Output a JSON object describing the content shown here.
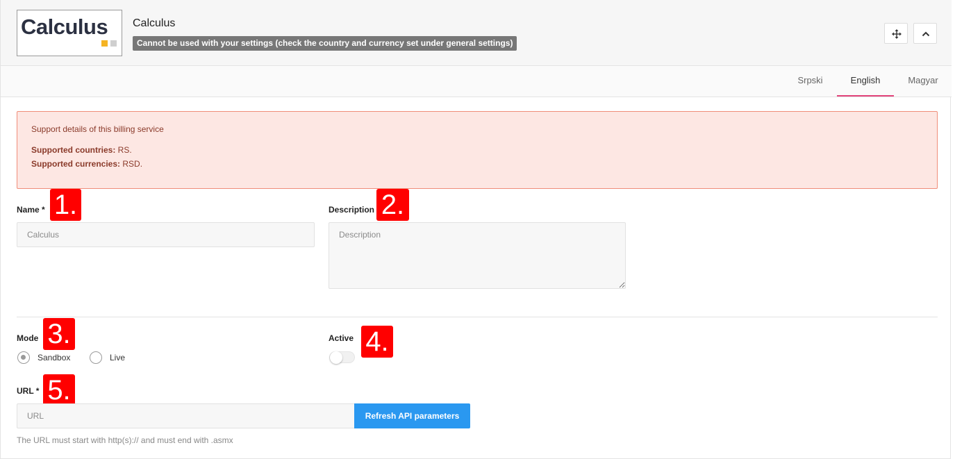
{
  "header": {
    "logo_text": "Calculus",
    "title": "Calculus",
    "badge": "Cannot be used with your settings (check the country and currency set under general settings)",
    "move_icon": "move-icon",
    "collapse_icon": "chevron-up-icon"
  },
  "tabs": [
    {
      "label": "Srpski",
      "active": false
    },
    {
      "label": "English",
      "active": true
    },
    {
      "label": "Magyar",
      "active": false
    }
  ],
  "alert": {
    "title": "Support details of this billing service",
    "countries_label": "Supported countries:",
    "countries_value": " RS.",
    "currencies_label": "Supported currencies:",
    "currencies_value": " RSD."
  },
  "form": {
    "name_label": "Name *",
    "name_placeholder": "Calculus",
    "description_label": "Description",
    "description_placeholder": "Description",
    "mode_label": "Mode",
    "mode_options": [
      {
        "label": "Sandbox",
        "checked": true
      },
      {
        "label": "Live",
        "checked": false
      }
    ],
    "active_label": "Active",
    "active_on": false,
    "url_label": "URL *",
    "url_placeholder": "URL",
    "refresh_button": "Refresh API parameters",
    "url_help": "The URL must start with http(s):// and must end with .asmx"
  },
  "markers": [
    "1.",
    "2.",
    "3.",
    "4.",
    "5."
  ],
  "colors": {
    "tab_active": "#e2437a",
    "alert_bg": "#fde7e3",
    "alert_border": "#f08d79",
    "primary": "#2a98f0",
    "marker": "#ff0000",
    "logo_yellow": "#f5b423"
  }
}
